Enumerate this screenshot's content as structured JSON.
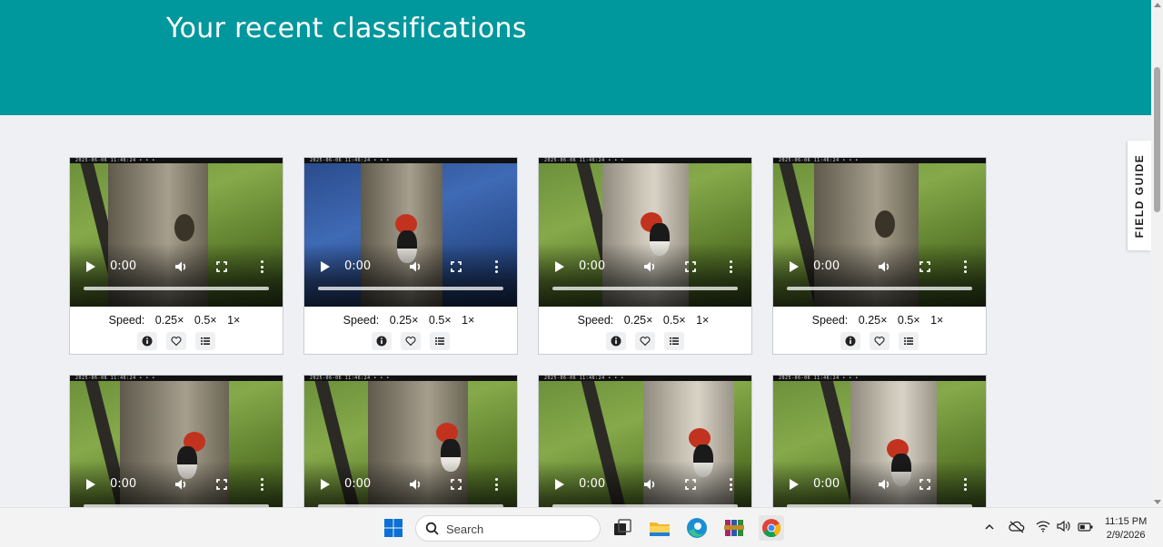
{
  "page": {
    "title": "Your recent classifications",
    "field_guide_label": "FIELD GUIDE"
  },
  "colors": {
    "banner": "#00979d",
    "page_bg": "#eef0f4"
  },
  "video_card": {
    "time": "0:00",
    "speed_label": "Speed:",
    "speed_options": [
      "0.25×",
      "0.5×",
      "1×"
    ],
    "action_icons": [
      "info-icon",
      "heart-icon",
      "list-icon"
    ]
  },
  "cards": [
    {
      "scene": "grass",
      "trunk": "dark",
      "bird": false
    },
    {
      "scene": "water",
      "trunk": "dark",
      "bird": true
    },
    {
      "scene": "grass",
      "trunk": "light",
      "bird": true
    },
    {
      "scene": "grass",
      "trunk": "dark",
      "bird": false
    },
    {
      "scene": "grass",
      "trunk": "dark",
      "bird": true
    },
    {
      "scene": "grass",
      "trunk": "dark",
      "bird": true
    },
    {
      "scene": "grass",
      "trunk": "light",
      "bird": true
    },
    {
      "scene": "grass",
      "trunk": "light",
      "bird": true
    }
  ],
  "taskbar": {
    "search_placeholder": "Search",
    "time": "11:15 PM",
    "date": "2/9/2026",
    "apps": [
      "windows-start-icon",
      "task-view-icon",
      "file-explorer-icon",
      "edge-icon",
      "winrar-icon",
      "chrome-icon"
    ],
    "tray": [
      "chevron-up-icon",
      "cloud-off-icon",
      "wifi-icon",
      "volume-icon",
      "battery-icon"
    ]
  }
}
